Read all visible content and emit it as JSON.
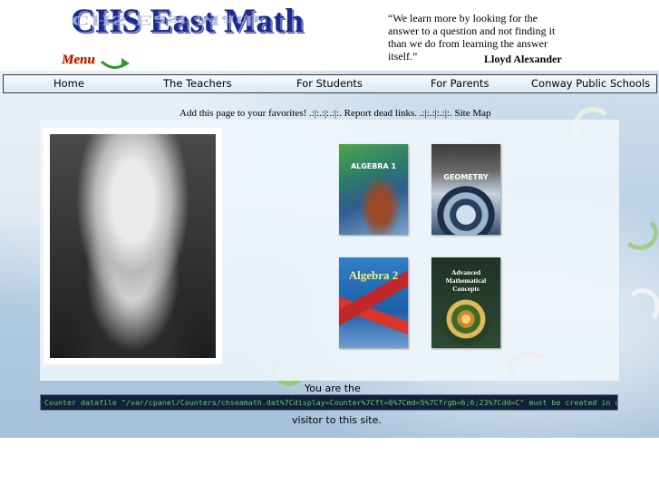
{
  "header": {
    "title": "CHS East Math",
    "menu_label": "Menu",
    "quote": "“We learn more by looking for the answer to a question and not finding it than we do from learning the answer itself.”",
    "quote_author": "Lloyd Alexander"
  },
  "nav": {
    "items": [
      {
        "label": "Home"
      },
      {
        "label": "The Teachers"
      },
      {
        "label": "For Students"
      },
      {
        "label": "For Parents"
      },
      {
        "label": "Conway Public Schools"
      }
    ]
  },
  "links": {
    "favorites": "Add this page to your favorites!",
    "sep1": " .:|:.:|:.:|:. ",
    "dead_links": "Report dead links.",
    "sep2": " .:|:.:|:.:|:. ",
    "site_map": "Site Map"
  },
  "books": [
    {
      "title": "ALGEBRA 1",
      "icon": "algebra-1-book-cover"
    },
    {
      "title": "GEOMETRY",
      "icon": "geometry-book-cover"
    },
    {
      "title": "Algebra 2",
      "icon": "algebra-2-book-cover"
    },
    {
      "title": "Advanced Mathematical Concepts",
      "icon": "advanced-math-book-cover"
    }
  ],
  "photo": {
    "icon": "einstein-photo"
  },
  "counter": {
    "prefix": "You are the",
    "message": "Counter datafile \"/var/cpanel/Counters/chseamath.dat%7Cdisplay=Counter%7Cft=6%7Cmd=5%7Cfrgb=6;6;23%7Cdd=C\" must be created in cPanel first!",
    "suffix": "visitor to this site."
  },
  "colors": {
    "title": "#1c2a8c",
    "menu": "#b01010",
    "counter_text": "#5cd35c",
    "counter_bg": "#12203a"
  }
}
